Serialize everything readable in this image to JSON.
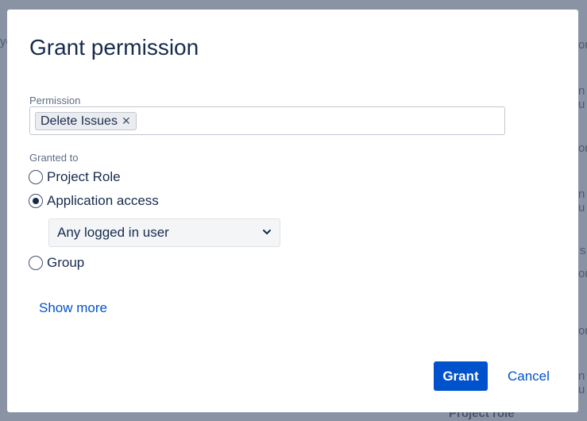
{
  "background": {
    "fragments": [
      "yo",
      "on",
      "n u",
      "on",
      "n u",
      "s",
      "on",
      "on",
      "n u",
      "on",
      "n u"
    ],
    "bold_fragment": "Project role"
  },
  "dialog": {
    "title": "Grant permission",
    "permission": {
      "label": "Permission",
      "selected_tag": "Delete Issues",
      "remove_glyph": "✕"
    },
    "granted_to": {
      "label": "Granted to",
      "options": [
        {
          "label": "Project Role",
          "checked": false
        },
        {
          "label": "Application access",
          "checked": true
        },
        {
          "label": "Group",
          "checked": false
        }
      ],
      "application_select_value": "Any logged in user"
    },
    "show_more_label": "Show more",
    "grant_label": "Grant",
    "cancel_label": "Cancel"
  },
  "colors": {
    "overlay": "#8993a4",
    "primary": "#0052cc",
    "text": "#172b4d",
    "label": "#5e6c84"
  },
  "icons": {
    "remove_tag": "close-icon",
    "select": "chevron-down-icon"
  }
}
